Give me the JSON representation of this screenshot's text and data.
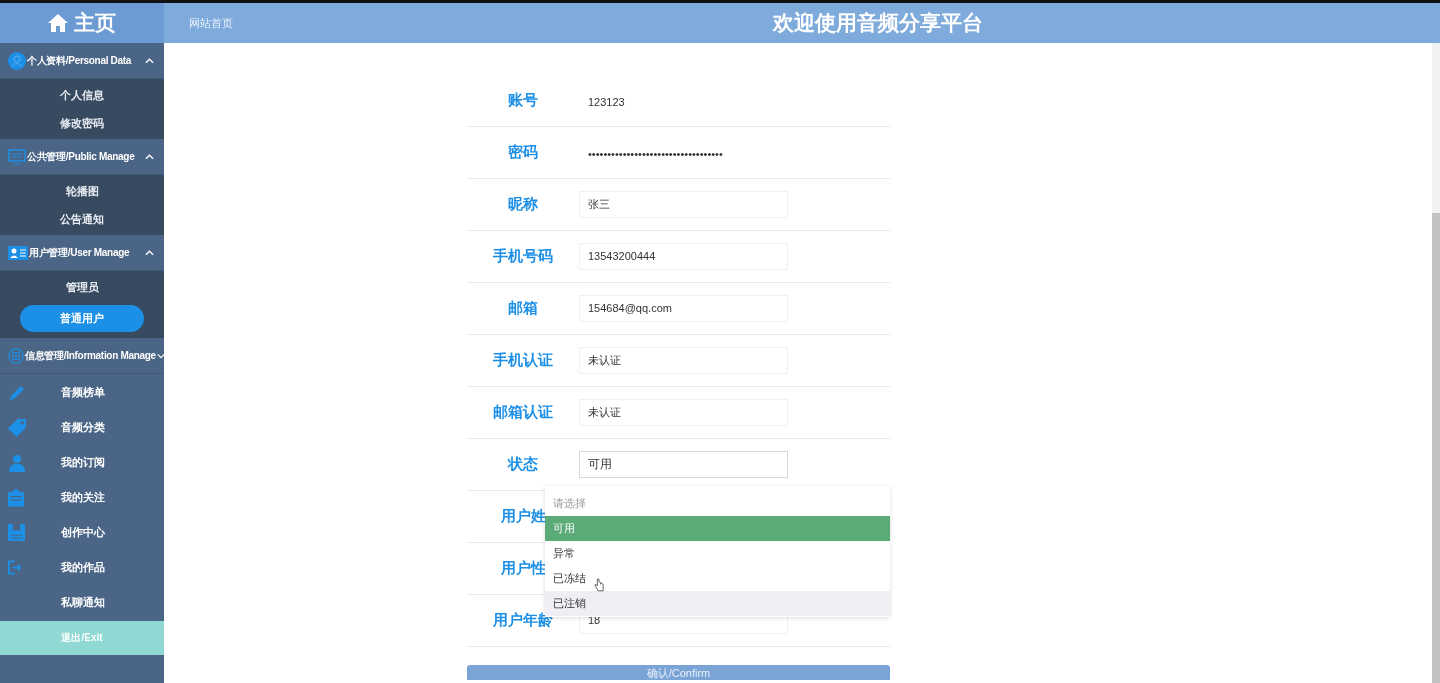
{
  "header": {
    "logo": "主页",
    "breadcrumb": "网站首页",
    "title": "欢迎使用音频分享平台"
  },
  "sidebar": {
    "groups": [
      {
        "title": "个人资料/Personal Data",
        "expanded": true,
        "kind": "plain",
        "items": [
          {
            "label": "个人信息",
            "selected": false
          },
          {
            "label": "修改密码",
            "selected": false
          }
        ]
      },
      {
        "title": "公共管理/Public Manage",
        "expanded": true,
        "kind": "plain",
        "items": [
          {
            "label": "轮播图",
            "selected": false
          },
          {
            "label": "公告通知",
            "selected": false
          }
        ]
      },
      {
        "title": "用户管理/User Manage",
        "expanded": true,
        "kind": "plain",
        "items": [
          {
            "label": "管理员",
            "selected": false
          },
          {
            "label": "普通用户",
            "selected": true
          }
        ]
      },
      {
        "title": "信息管理/Information Manage",
        "expanded": false,
        "kind": "icons",
        "items": [
          {
            "label": "音频榜单",
            "selected": false
          },
          {
            "label": "音频分类",
            "selected": false
          },
          {
            "label": "我的订阅",
            "selected": false
          },
          {
            "label": "我的关注",
            "selected": false
          },
          {
            "label": "创作中心",
            "selected": false
          },
          {
            "label": "我的作品",
            "selected": false
          },
          {
            "label": "私聊通知",
            "selected": false
          }
        ]
      }
    ],
    "exit": "退出/Exit"
  },
  "form": {
    "fields": [
      {
        "label": "账号",
        "kind": "text",
        "value": "123123"
      },
      {
        "label": "密码",
        "kind": "text",
        "value": "•••••••••••••••••••••••••••••••••••"
      },
      {
        "label": "昵称",
        "kind": "input",
        "value": "张三"
      },
      {
        "label": "手机号码",
        "kind": "input",
        "value": "13543200444"
      },
      {
        "label": "邮箱",
        "kind": "input",
        "value": "154684@qq.com"
      },
      {
        "label": "手机认证",
        "kind": "input",
        "value": "未认证"
      },
      {
        "label": "邮箱认证",
        "kind": "input",
        "value": "未认证"
      },
      {
        "label": "状态",
        "kind": "select",
        "value": "可用"
      },
      {
        "label": "用户姓"
      },
      {
        "label": "用户性"
      },
      {
        "label": "用户年龄",
        "kind": "input",
        "value": "18"
      }
    ],
    "dropdown": {
      "options": [
        {
          "label": "请选择",
          "kind": "placeholder",
          "selected": false,
          "hovered": false
        },
        {
          "label": "可用",
          "kind": "option",
          "selected": true,
          "hovered": false
        },
        {
          "label": "异常",
          "kind": "option",
          "selected": false,
          "hovered": false
        },
        {
          "label": "已冻结",
          "kind": "option",
          "selected": false,
          "hovered": false
        },
        {
          "label": "已注销",
          "kind": "option",
          "selected": false,
          "hovered": true
        }
      ]
    },
    "submit": "确认/Confirm"
  }
}
